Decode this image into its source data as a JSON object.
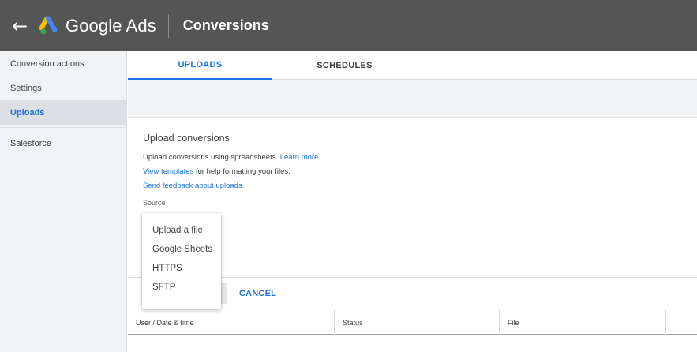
{
  "topbar": {
    "back_glyph": "←",
    "brand": "Google Ads",
    "page_title": "Conversions",
    "logo_icon": "google-ads-logo",
    "colors": {
      "bar": "#555555",
      "logo_blue": "#4285F4",
      "logo_yellow": "#FBBC04",
      "logo_green": "#34A853"
    }
  },
  "sidebar": {
    "items": [
      {
        "label": "Conversion actions",
        "active": false
      },
      {
        "label": "Settings",
        "active": false
      },
      {
        "label": "Uploads",
        "active": true
      },
      {
        "label": "Salesforce",
        "active": false
      }
    ]
  },
  "tabs": [
    {
      "label": "UPLOADS",
      "active": true
    },
    {
      "label": "SCHEDULES",
      "active": false
    }
  ],
  "upload": {
    "title": "Upload conversions",
    "line1_text": "Upload conversions using spreadsheets. ",
    "line1_link": "Learn more",
    "line2_link": "View templates",
    "line2_text": " for help formatting your files.",
    "line3_link": "Send feedback about uploads",
    "source_label": "Source"
  },
  "source_menu": {
    "options": [
      "Upload a file",
      "Google Sheets",
      "HTTPS",
      "SFTP"
    ]
  },
  "actions": {
    "cancel_label": "CANCEL"
  },
  "table": {
    "columns": [
      "User / Date & time",
      "Status",
      "File",
      ""
    ]
  },
  "accent_color": "#1a73e8"
}
